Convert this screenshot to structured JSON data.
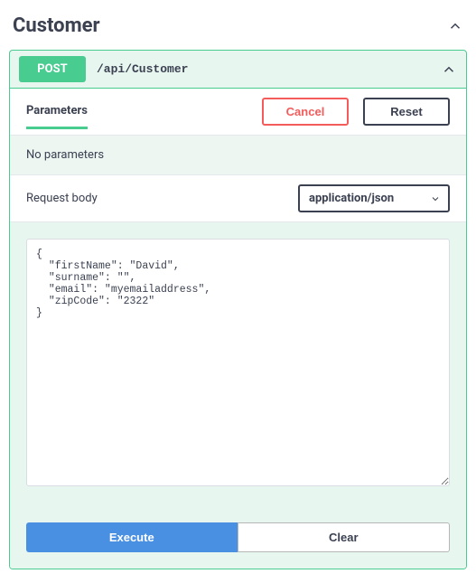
{
  "section": {
    "title": "Customer"
  },
  "operation": {
    "method": "POST",
    "path": "/api/Customer"
  },
  "tabs": {
    "parameters_label": "Parameters"
  },
  "buttons": {
    "cancel": "Cancel",
    "reset": "Reset",
    "execute": "Execute",
    "clear": "Clear"
  },
  "params": {
    "empty_message": "No parameters"
  },
  "request_body": {
    "label": "Request body",
    "content_type": "application/json",
    "value": "{\n  \"firstName\": \"David\",\n  \"surname\": \"\",\n  \"email\": \"myemailaddress\",\n  \"zipCode\": \"2322\"\n}"
  }
}
